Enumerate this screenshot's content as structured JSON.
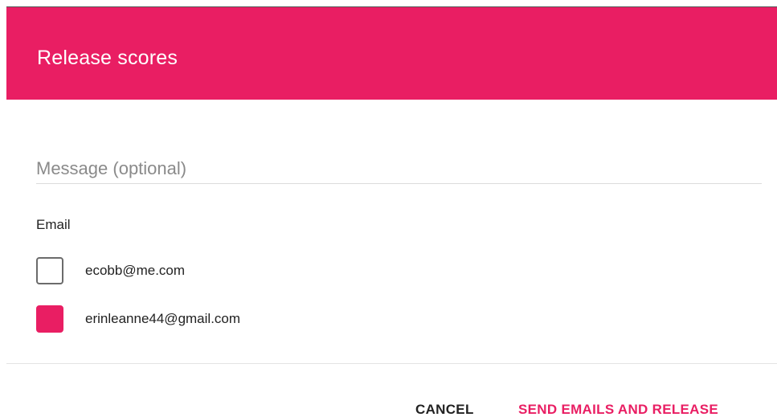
{
  "colors": {
    "accent": "#e91e63"
  },
  "dialog": {
    "title": "Release scores"
  },
  "message": {
    "placeholder": "Message (optional)",
    "value": ""
  },
  "email_section": {
    "label": "Email",
    "options": [
      {
        "address": "ecobb@me.com",
        "checked": false
      },
      {
        "address": "erinleanne44@gmail.com",
        "checked": true
      }
    ]
  },
  "actions": {
    "cancel_label": "CANCEL",
    "send_label": "SEND EMAILS AND RELEASE"
  }
}
